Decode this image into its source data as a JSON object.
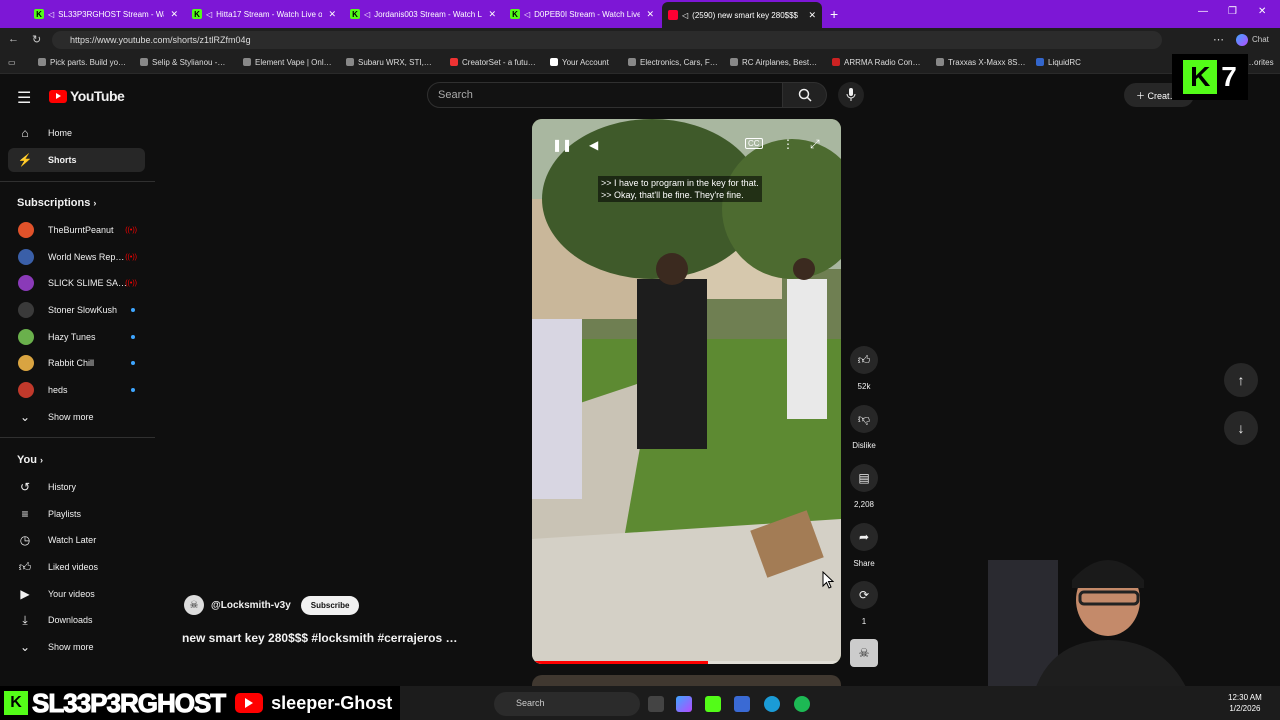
{
  "browser": {
    "tabs": [
      {
        "title": "SL33P3RGHOST Stream - Wat…",
        "icon": "kick"
      },
      {
        "title": "Hitta17 Stream - Watch Live o…",
        "icon": "kick"
      },
      {
        "title": "Jordanis003 Stream - Watch L…",
        "icon": "kick"
      },
      {
        "title": "D0PEB0I Stream - Watch Live",
        "icon": "kick"
      },
      {
        "title": "(2590) new smart key 280$$$",
        "icon": "youtube",
        "active": true
      }
    ],
    "url": "https://www.youtube.com/shorts/z1tlRZfm04g",
    "bookmarks": [
      "Pick parts. Build yo…",
      "Selip & Stylianou -…",
      "Element Vape | Onl…",
      "Subaru WRX, STI,…",
      "CreatorSet - a futu…",
      "Your Account",
      "Electronics, Cars, F…",
      "RC Airplanes, Best…",
      "ARRMA Radio Con…",
      "Traxxas X-Maxx 8S…",
      "LiquidRC"
    ],
    "bookmarks_more": "…orites",
    "chat_label": "Chat"
  },
  "youtube": {
    "logo": "YouTube",
    "search_placeholder": "Search",
    "create_label": "Creat…",
    "kick_count": "7",
    "sidebar": {
      "main": [
        {
          "label": "Home",
          "icon": "home-icon"
        },
        {
          "label": "Shorts",
          "icon": "shorts-icon",
          "active": true
        }
      ],
      "subscriptions_title": "Subscriptions",
      "subscriptions": [
        {
          "label": "TheBurntPeanut",
          "status": "live",
          "color": "#e0522a"
        },
        {
          "label": "World News Rep…",
          "status": "live",
          "color": "#3a5fa8"
        },
        {
          "label": "SLICK SLIME SA…",
          "status": "live",
          "color": "#8a3ab8"
        },
        {
          "label": "Stoner SlowKush",
          "status": "dot",
          "color": "#3a3a3a"
        },
        {
          "label": "Hazy Tunes",
          "status": "dot",
          "color": "#6ab04c"
        },
        {
          "label": "Rabbit Chill",
          "status": "dot",
          "color": "#d9a441"
        },
        {
          "label": "heds",
          "status": "dot",
          "color": "#c0392b"
        }
      ],
      "show_more": "Show more",
      "you_title": "You",
      "you_items": [
        {
          "label": "History",
          "icon": "history-icon"
        },
        {
          "label": "Playlists",
          "icon": "playlists-icon"
        },
        {
          "label": "Watch Later",
          "icon": "watch-later-icon"
        },
        {
          "label": "Liked videos",
          "icon": "like-icon"
        },
        {
          "label": "Your videos",
          "icon": "your-videos-icon"
        },
        {
          "label": "Downloads",
          "icon": "download-icon"
        }
      ],
      "show_more_2": "Show more"
    },
    "short": {
      "captions": ">> I have to program in the key for that.\n>> Okay, that'll be fine. They're fine.",
      "progress": 0.57,
      "channel": "@Locksmith-v3y",
      "subscribe_label": "Subscribe",
      "title": "new smart key 280$$$ #locksmith #cerrajeros …",
      "actions": [
        {
          "label": "52k",
          "icon": "like-icon"
        },
        {
          "label": "Dislike",
          "icon": "dislike-icon"
        },
        {
          "label": "2,208",
          "icon": "comment-icon"
        },
        {
          "label": "Share",
          "icon": "share-icon"
        },
        {
          "label": "1",
          "icon": "remix-icon"
        }
      ]
    }
  },
  "stream_overlay": {
    "name": "SL33P3RGHOST",
    "handle": "sleeper-Ghost"
  },
  "taskbar": {
    "search_placeholder": "Search",
    "time": "12:30 AM",
    "date": "1/2/2026"
  }
}
